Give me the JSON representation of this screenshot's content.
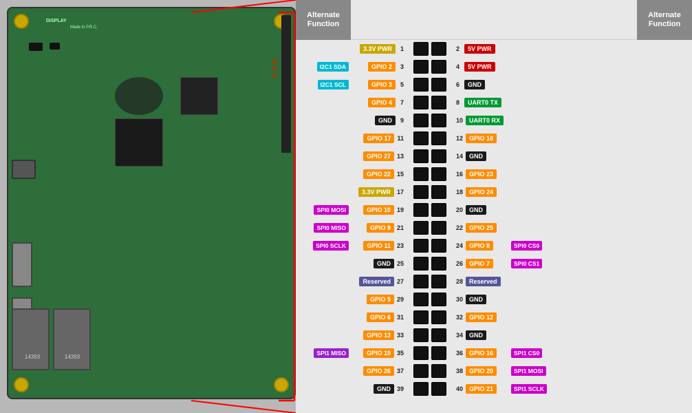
{
  "header": {
    "left_alt_label": "Alternate\nFunction",
    "right_alt_label": "Alternate\nFunction"
  },
  "pins": [
    {
      "left_alt": "",
      "left_label": "3.3V PWR",
      "left_color": "c-yellow",
      "left_num": "1",
      "right_num": "2",
      "right_label": "5V PWR",
      "right_color": "c-red",
      "right_alt": ""
    },
    {
      "left_alt": "I2C1 SDA",
      "left_alt_color": "c-cyan",
      "left_label": "GPIO 2",
      "left_color": "c-orange",
      "left_num": "3",
      "right_num": "4",
      "right_label": "5V PWR",
      "right_color": "c-red",
      "right_alt": ""
    },
    {
      "left_alt": "I2C1 SCL",
      "left_alt_color": "c-cyan",
      "left_label": "GPIO 3",
      "left_color": "c-orange",
      "left_num": "5",
      "right_num": "6",
      "right_label": "GND",
      "right_color": "c-black",
      "right_alt": ""
    },
    {
      "left_alt": "",
      "left_label": "GPIO 4",
      "left_color": "c-orange",
      "left_num": "7",
      "right_num": "8",
      "right_label": "UART0 TX",
      "right_color": "c-green",
      "right_alt": ""
    },
    {
      "left_alt": "",
      "left_label": "GND",
      "left_color": "c-black",
      "left_num": "9",
      "right_num": "10",
      "right_label": "UART0 RX",
      "right_color": "c-green",
      "right_alt": ""
    },
    {
      "left_alt": "",
      "left_label": "GPIO 17",
      "left_color": "c-orange",
      "left_num": "11",
      "right_num": "12",
      "right_label": "GPIO 18",
      "right_color": "c-orange",
      "right_alt": ""
    },
    {
      "left_alt": "",
      "left_label": "GPIO 27",
      "left_color": "c-orange",
      "left_num": "13",
      "right_num": "14",
      "right_label": "GND",
      "right_color": "c-black",
      "right_alt": ""
    },
    {
      "left_alt": "",
      "left_label": "GPIO 22",
      "left_color": "c-orange",
      "left_num": "15",
      "right_num": "16",
      "right_label": "GPIO 23",
      "right_color": "c-orange",
      "right_alt": ""
    },
    {
      "left_alt": "",
      "left_label": "3.3V PWR",
      "left_color": "c-yellow",
      "left_num": "17",
      "right_num": "18",
      "right_label": "GPIO 24",
      "right_color": "c-orange",
      "right_alt": ""
    },
    {
      "left_alt": "SPI0 MOSI",
      "left_alt_color": "c-magenta",
      "left_label": "GPIO 10",
      "left_color": "c-orange",
      "left_num": "19",
      "right_num": "20",
      "right_label": "GND",
      "right_color": "c-black",
      "right_alt": ""
    },
    {
      "left_alt": "SPI0 MISO",
      "left_alt_color": "c-magenta",
      "left_label": "GPIO 9",
      "left_color": "c-orange",
      "left_num": "21",
      "right_num": "22",
      "right_label": "GPIO 25",
      "right_color": "c-orange",
      "right_alt": ""
    },
    {
      "left_alt": "SPI0 SCLK",
      "left_alt_color": "c-magenta",
      "left_label": "GPIO 11",
      "left_color": "c-orange",
      "left_num": "23",
      "right_num": "24",
      "right_label": "GPIO 8",
      "right_color": "c-orange",
      "right_alt": "SPI0 CS0"
    },
    {
      "left_alt": "",
      "left_label": "GND",
      "left_color": "c-black",
      "left_num": "25",
      "right_num": "26",
      "right_label": "GPIO 7",
      "right_color": "c-orange",
      "right_alt": "SPI0 CS1"
    },
    {
      "left_alt": "",
      "left_label": "Reserved",
      "left_color": "c-blue",
      "left_num": "27",
      "right_num": "28",
      "right_label": "Reserved",
      "right_color": "c-blue",
      "right_alt": ""
    },
    {
      "left_alt": "",
      "left_label": "GPIO 5",
      "left_color": "c-orange",
      "left_num": "29",
      "right_num": "30",
      "right_label": "GND",
      "right_color": "c-black",
      "right_alt": ""
    },
    {
      "left_alt": "",
      "left_label": "GPIO 6",
      "left_color": "c-orange",
      "left_num": "31",
      "right_num": "32",
      "right_label": "GPIO 12",
      "right_color": "c-orange",
      "right_alt": ""
    },
    {
      "left_alt": "",
      "left_label": "GPIO 13",
      "left_color": "c-orange",
      "left_num": "33",
      "right_num": "34",
      "right_label": "GND",
      "right_color": "c-black",
      "right_alt": ""
    },
    {
      "left_alt": "SPI1 MISO",
      "left_alt_color": "c-purple",
      "left_label": "GPIO 19",
      "left_color": "c-orange",
      "left_num": "35",
      "right_num": "36",
      "right_label": "GPIO 16",
      "right_color": "c-orange",
      "right_alt": "SPI1 CS0"
    },
    {
      "left_alt": "",
      "left_label": "GPIO 26",
      "left_color": "c-orange",
      "left_num": "37",
      "right_num": "38",
      "right_label": "GPIO 20",
      "right_color": "c-orange",
      "right_alt": "SPI1 MOSI"
    },
    {
      "left_alt": "",
      "left_label": "GND",
      "left_color": "c-black",
      "left_num": "39",
      "right_num": "40",
      "right_label": "GPIO 21",
      "right_color": "c-orange",
      "right_alt": "SPI1 SCLK"
    }
  ]
}
